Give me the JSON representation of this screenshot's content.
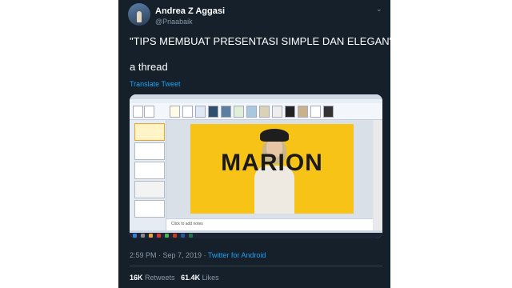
{
  "tweet": {
    "name": "Andrea Z Aggasi",
    "handle": "@Priaabaik",
    "text_line1": "\"TIPS MEMBUAT PRESENTASI SIMPLE DAN ELEGAN\"",
    "text_line2": "a thread",
    "translate": "Translate Tweet",
    "time": "2:59 PM · Sep 7, 2019 · ",
    "source": "Twitter for Android",
    "retweets_count": "16K",
    "retweets_label": "Retweets",
    "likes_count": "61.4K",
    "likes_label": "Likes"
  },
  "screenshot": {
    "slide_title": "MARION",
    "notes_placeholder": "Click to add notes"
  },
  "colors": {
    "background": "#15202b",
    "accent": "#1da1f2",
    "muted": "#8899a6",
    "slide_bg": "#f6c316"
  },
  "icons": [
    "chevron-down-icon",
    "avatar"
  ]
}
